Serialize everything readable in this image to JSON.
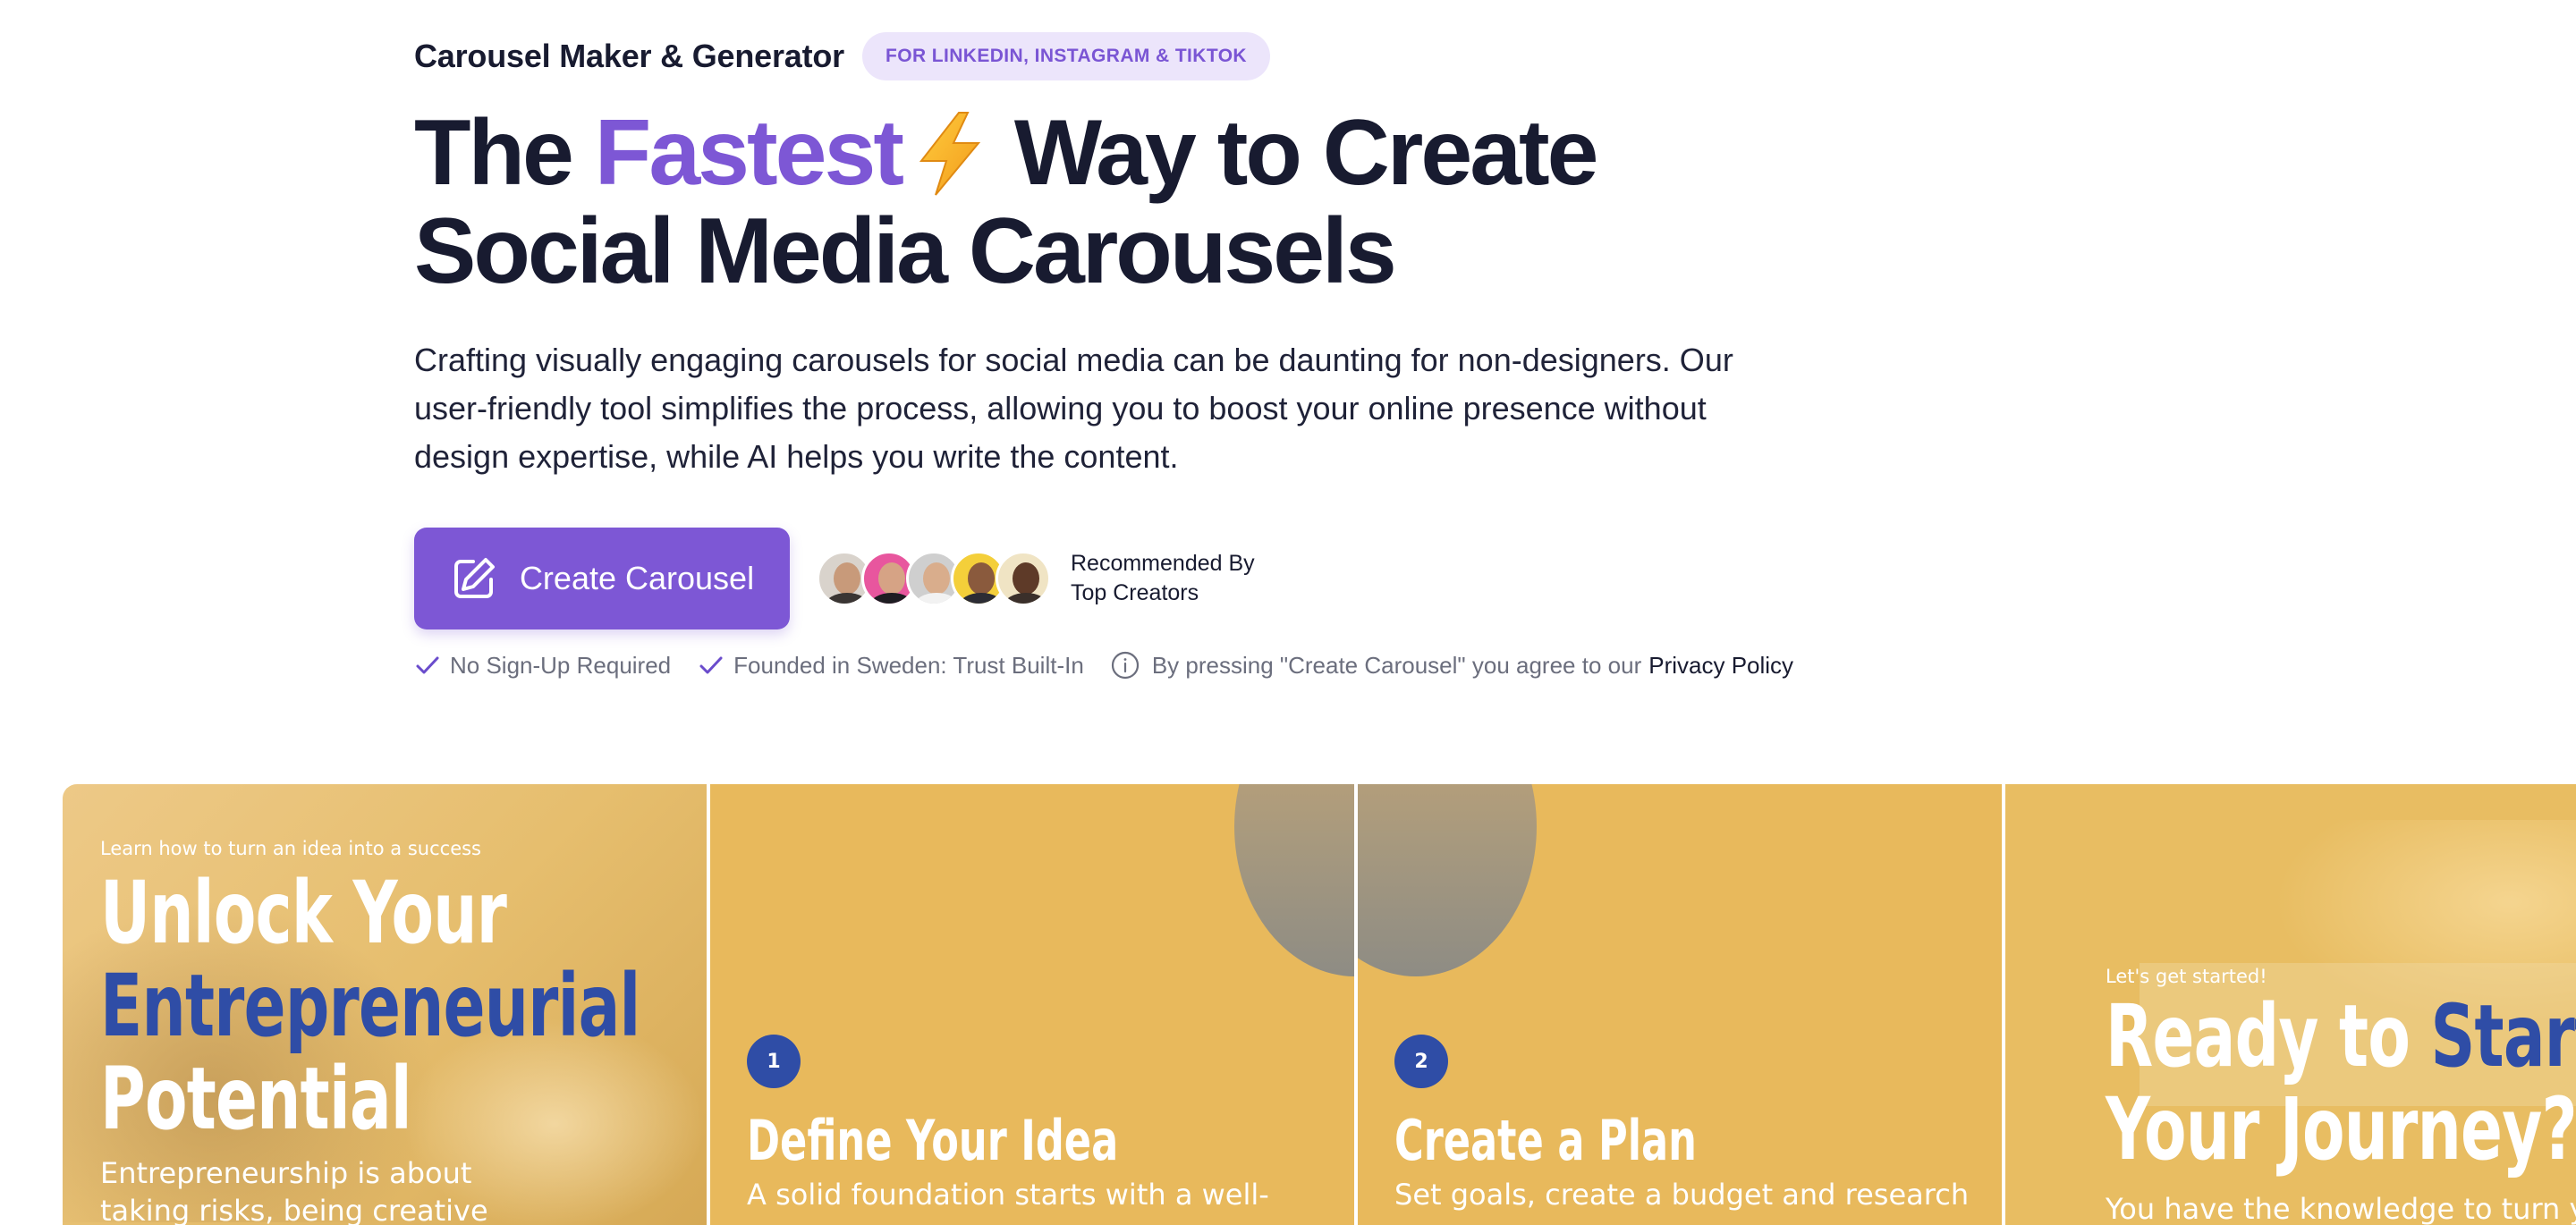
{
  "header": {
    "eyebrow_title": "Carousel Maker & Generator",
    "eyebrow_badge": "FOR LINKEDIN, INSTAGRAM & TIKTOK"
  },
  "headline": {
    "part1": "The ",
    "accent": "Fastest",
    "part2": " Way to Create",
    "line2": "Social Media Carousels",
    "icon": "lightning-bolt-icon"
  },
  "description": "Crafting visually engaging carousels for social media can be daunting for non-designers. Our user-friendly tool simplifies the process, allowing you to boost your online presence without design expertise, while AI helps you write the content.",
  "cta": {
    "button_label": "Create Carousel",
    "icon": "edit-icon"
  },
  "social_proof": {
    "line1": "Recommended By",
    "line2": "Top Creators",
    "avatar_count": 5
  },
  "trust": {
    "items": [
      "No Sign-Up Required",
      "Founded in Sweden: Trust Built-In"
    ],
    "consent_text": "By pressing \"Create Carousel\" you agree to our",
    "privacy_link": "Privacy Policy"
  },
  "colors": {
    "accent": "#7d57d5",
    "badge_bg": "#ece5fb",
    "slide_bg": "#e8b95c",
    "slide_blue": "#2f4da6"
  },
  "carousel": {
    "slides": [
      {
        "kicker": "Learn how to turn an idea into a success",
        "title_line1": "Unlock Your",
        "title_line2": "Entrepreneurial",
        "title_line3": "Potential",
        "body_line1": "Entrepreneurship is about",
        "body_line2": "taking risks, being creative"
      },
      {
        "number": "1",
        "title": "Define Your Idea",
        "body": "A solid foundation starts with a well-"
      },
      {
        "number": "2",
        "title": "Create a Plan",
        "body": "Set goals, create a budget and research"
      },
      {
        "kicker": "Let's get started!",
        "title_a": "Ready to ",
        "title_b": "Start",
        "title_line2": "Your Journey?",
        "body": "You have the knowledge to turn your"
      }
    ]
  }
}
